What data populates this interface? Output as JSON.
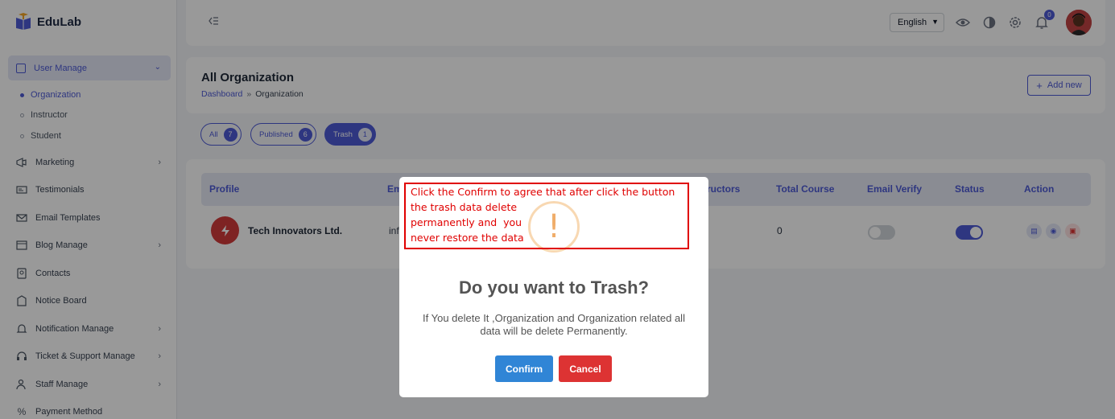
{
  "brand": {
    "name": "EduLab"
  },
  "sidebar": {
    "group": {
      "label": "User Manage"
    },
    "sub_items": [
      {
        "label": "Organization",
        "active": true
      },
      {
        "label": "Instructor",
        "active": false
      },
      {
        "label": "Student",
        "active": false
      }
    ],
    "items": [
      {
        "label": "Marketing",
        "icon": "megaphone-icon",
        "has_arrow": true
      },
      {
        "label": "Testimonials",
        "icon": "id-card-icon",
        "has_arrow": false
      },
      {
        "label": "Email Templates",
        "icon": "mail-icon",
        "has_arrow": false
      },
      {
        "label": "Blog Manage",
        "icon": "blog-icon",
        "has_arrow": true
      },
      {
        "label": "Contacts",
        "icon": "contact-icon",
        "has_arrow": false
      },
      {
        "label": "Notice Board",
        "icon": "notice-icon",
        "has_arrow": false
      },
      {
        "label": "Notification Manage",
        "icon": "bell-icon",
        "has_arrow": true
      },
      {
        "label": "Ticket & Support Manage",
        "icon": "headset-icon",
        "has_arrow": true
      },
      {
        "label": "Staff Manage",
        "icon": "staff-icon",
        "has_arrow": true
      },
      {
        "label": "Payment Method",
        "icon": "percent-icon",
        "has_arrow": false
      }
    ]
  },
  "header": {
    "language": "English",
    "notification_count": "0"
  },
  "page": {
    "title": "All Organization",
    "breadcrumb": {
      "root": "Dashboard",
      "sep": "»",
      "current": "Organization"
    },
    "add_button": "Add new",
    "tabs": [
      {
        "label": "All",
        "count": "7",
        "active": false
      },
      {
        "label": "Published",
        "count": "6",
        "active": false
      },
      {
        "label": "Trash",
        "count": "1",
        "active": true
      }
    ]
  },
  "table": {
    "headers": [
      "Profile",
      "Em",
      "tructors",
      "Total Course",
      "Email Verify",
      "Status",
      "Action"
    ],
    "row": {
      "name": "Tech Innovators Ltd.",
      "email": "inf",
      "total_course": "0",
      "email_verify": false,
      "status": true
    }
  },
  "modal": {
    "title": "Do you want to Trash?",
    "text": "If You delete It ,Organization and Organization related all data will be delete Permanently.",
    "confirm": "Confirm",
    "cancel": "Cancel"
  },
  "annotation": {
    "lines": [
      "Click the Confirm to agree that after click the button",
      "the trash data delete",
      "permanently and  you",
      "never restore the data"
    ]
  },
  "colors": {
    "accent": "#4d5ad6",
    "confirm": "#3085d6",
    "cancel": "#dd3333",
    "annotation": "#e00000",
    "warning": "#f0ad6a"
  }
}
